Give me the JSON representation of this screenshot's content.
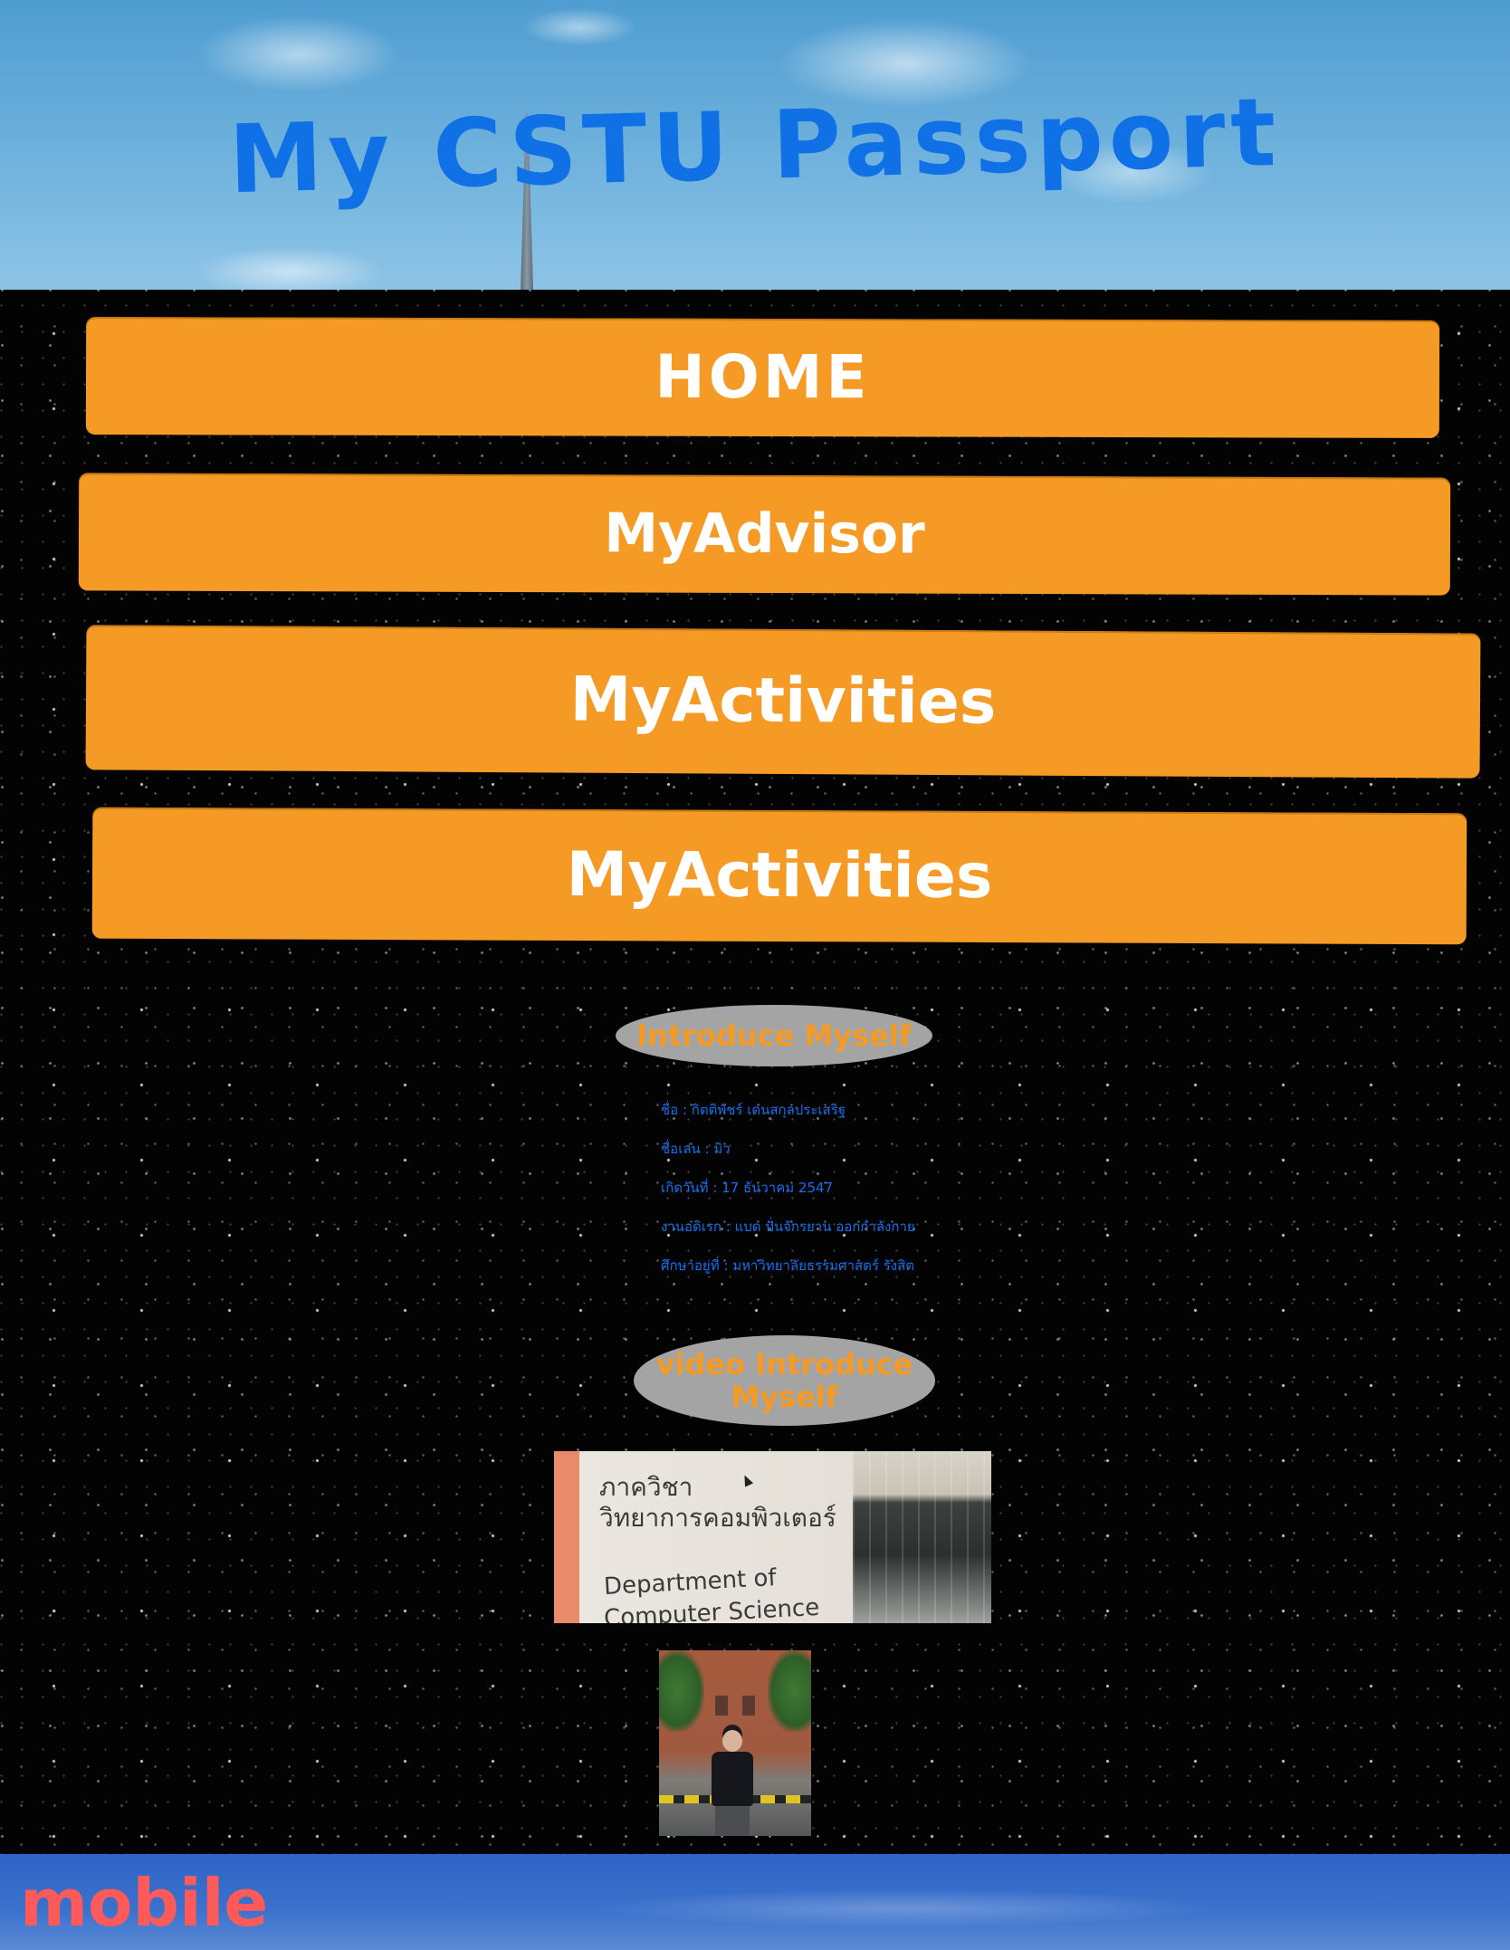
{
  "header": {
    "title": "My CSTU Passport"
  },
  "nav": {
    "items": [
      {
        "label": "HOME"
      },
      {
        "label": "MyAdvisor"
      },
      {
        "label": "MyActivities"
      },
      {
        "label": "MyActivities"
      }
    ]
  },
  "intro": {
    "heading": "Introduce Myself",
    "lines": [
      "ชื่อ : กิตติพัชร์ เด่นสกุลประเสริฐ",
      "ชื่อเล่น : มิว",
      "เกิดวันที่ : 17 ธันวาคม 2547",
      "งานอดิเรก : แบด ปั่นจักรยาน ออกกำลังกาย",
      "ศึกษาอยู่ที่ : มหาวิทยาลัยธรรมศาสตร์ รังสิต"
    ]
  },
  "video": {
    "heading": "video Introduce Myself",
    "thumbnail": {
      "sign_line1": "ภาควิชา",
      "sign_line2": "วิทยาการคอมพิวเตอร์",
      "sign_line3": "Department of",
      "sign_line4": "Computer Science"
    }
  },
  "footer": {
    "label": "mobile"
  },
  "colors": {
    "title": "#1070e6",
    "button": "#f49a25",
    "button_text": "#ffffff",
    "pill_bg": "#a4a4a4",
    "pill_text": "#f49a25",
    "info_text": "#1670ee",
    "footer_label": "#ff5a5a"
  }
}
